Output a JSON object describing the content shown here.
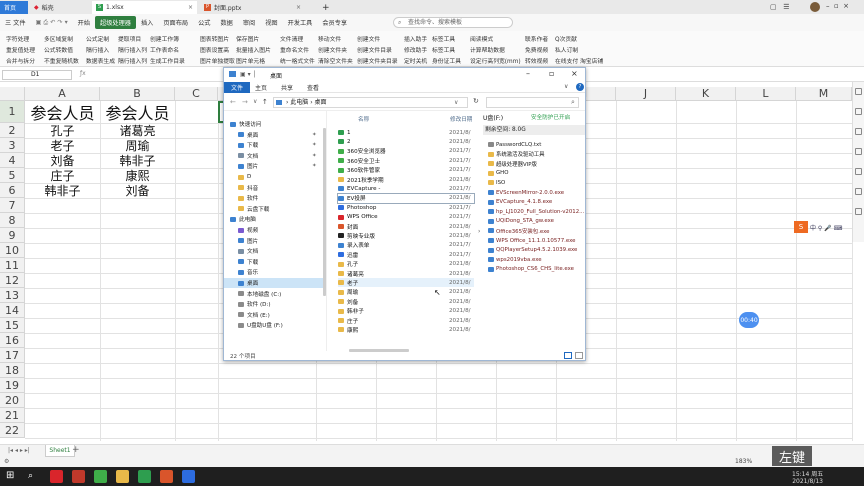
{
  "tabs": [
    {
      "label": "首页"
    },
    {
      "label": "稻壳"
    },
    {
      "label": "1.xlsx"
    },
    {
      "label": "封面.pptx"
    }
  ],
  "menus": [
    "三 文件",
    "开始",
    "超级处理器",
    "插入",
    "页面布局",
    "公式",
    "数据",
    "审阅",
    "视图",
    "开发工具",
    "会员专享"
  ],
  "search_placeholder": "查找命令、搜索模板",
  "ribbon": {
    "row1": [
      "字符处理",
      "多区域复制",
      "公式定制",
      "提取项目",
      "创建工作簿",
      "图表转图片",
      "保存图片",
      "文件清理",
      "移动文件",
      "创建文件",
      "插入助手",
      "标签工具",
      "阅读模式",
      "联系作者",
      "Q次贡献"
    ],
    "row2": [
      "重复值处理",
      "公式转数值",
      "隔行插入",
      "隔行插入列",
      "工作表命名",
      "图表设置高",
      "批量插入图片",
      "重命名文件",
      "创建文件夹",
      "创建文件目录",
      "修改助手",
      "标签工具",
      "计算帮助数据",
      "免费视频",
      "私人订制"
    ],
    "row3": [
      "合并与拆分",
      "不重复随机数",
      "数据表生成",
      "隔行插入列",
      "生成工作目录",
      "图片单独提取",
      "图片单元格",
      "统一格式文件",
      "清除空文件夹",
      "创建文件夹目录",
      "定时关机",
      "身份证工具",
      "设定行高列宽(mm)",
      "转效视频",
      "在线支付",
      "淘宝店铺"
    ]
  },
  "name_box": "D1",
  "columns": [
    "A",
    "B",
    "C",
    "D",
    "E",
    "F",
    "G",
    "H",
    "I",
    "J",
    "K",
    "L",
    "M"
  ],
  "rows": [
    "1",
    "2",
    "3",
    "4",
    "5",
    "6",
    "7",
    "8",
    "9",
    "10",
    "11",
    "12",
    "13",
    "14",
    "15",
    "16",
    "17",
    "18",
    "19",
    "20",
    "21",
    "22"
  ],
  "cells": {
    "a1": "参会人员",
    "b1": "参会人员",
    "a2": "孔子",
    "b2": "诸葛亮",
    "a3": "老子",
    "b3": "周瑜",
    "a4": "刘备",
    "b4": "韩非子",
    "a5": "庄子",
    "b5": "康熙",
    "a6": "韩非子",
    "b6": "刘备"
  },
  "explorer": {
    "title": "桌面",
    "tabs": [
      "文件",
      "主页",
      "共享",
      "查看"
    ],
    "path": "› 此电脑 › 桌面",
    "nav": [
      {
        "label": "快速访问",
        "kind": "star"
      },
      {
        "label": "桌面",
        "kind": "desk"
      },
      {
        "label": "下载",
        "kind": "down"
      },
      {
        "label": "文档",
        "kind": "doc"
      },
      {
        "label": "图片",
        "kind": "pic"
      },
      {
        "label": "D",
        "kind": "fold"
      },
      {
        "label": "抖音",
        "kind": "fold"
      },
      {
        "label": "软件",
        "kind": "fold"
      },
      {
        "label": "云盘下载",
        "kind": "fold"
      },
      {
        "label": "此电脑",
        "kind": "pc"
      },
      {
        "label": "视频",
        "kind": "vid"
      },
      {
        "label": "图片",
        "kind": "pic"
      },
      {
        "label": "文档",
        "kind": "doc"
      },
      {
        "label": "下载",
        "kind": "down"
      },
      {
        "label": "音乐",
        "kind": "mus"
      },
      {
        "label": "桌面",
        "kind": "desk"
      },
      {
        "label": "本地磁盘 (C:)",
        "kind": "drv"
      },
      {
        "label": "软件 (D:)",
        "kind": "drv"
      },
      {
        "label": "文档 (E:)",
        "kind": "drv"
      },
      {
        "label": "U盘助U盘 (F:)",
        "kind": "drv"
      }
    ],
    "col_name": "名称",
    "col_date": "修改日期",
    "files": [
      {
        "name": "1",
        "date": "2021/8/"
      },
      {
        "name": "2",
        "date": "2021/8/"
      },
      {
        "name": "360安全浏览器",
        "date": "2021/7/"
      },
      {
        "name": "360安全卫士",
        "date": "2021/7/"
      },
      {
        "name": "360软件管家",
        "date": "2021/7/"
      },
      {
        "name": "2021秋季学期",
        "date": "2021/8/"
      },
      {
        "name": "EVCapture -",
        "date": "2021/7/"
      },
      {
        "name": "EV投屏",
        "date": "2021/8/"
      },
      {
        "name": "Photoshop",
        "date": "2021/7/"
      },
      {
        "name": "WPS Office",
        "date": "2021/7/"
      },
      {
        "name": "封面",
        "date": "2021/8/"
      },
      {
        "name": "剪映专业版",
        "date": "2021/8/"
      },
      {
        "name": "录入表单",
        "date": "2021/7/"
      },
      {
        "name": "迅雷",
        "date": "2021/7/"
      },
      {
        "name": "孔子",
        "date": "2021/8/"
      },
      {
        "name": "诸葛亮",
        "date": "2021/8/"
      },
      {
        "name": "老子",
        "date": "2021/8/"
      },
      {
        "name": "周瑜",
        "date": "2021/8/"
      },
      {
        "name": "刘备",
        "date": "2021/8/"
      },
      {
        "name": "韩非子",
        "date": "2021/8/"
      },
      {
        "name": "庄子",
        "date": "2021/8/"
      },
      {
        "name": "康熙",
        "date": "2021/8/"
      }
    ],
    "usb_title": "U盘(F:)",
    "usb_protect": "安全防护已开启",
    "usb_free": "剩余空间: 8.0G",
    "usb_files": [
      {
        "name": "PasswordCLQ.txt",
        "kind": "txt"
      },
      {
        "name": "系统激活及驱动工具",
        "kind": "fold"
      },
      {
        "name": "超级处理器VIP版",
        "kind": "fold"
      },
      {
        "name": "GHO",
        "kind": "fold"
      },
      {
        "name": "ISO",
        "kind": "fold"
      },
      {
        "name": "EVScreenMirror-2.0.0.exe",
        "kind": "exe"
      },
      {
        "name": "EVCapture_4.1.8.exe",
        "kind": "exe"
      },
      {
        "name": "hp_LJ1020_Full_Solution-v2012...",
        "kind": "exe"
      },
      {
        "name": "UQiDong_STA_gw.exe",
        "kind": "exe"
      },
      {
        "name": "Office365安装包.exe",
        "kind": "exe"
      },
      {
        "name": "WPS Office_11.1.0.10577.exe",
        "kind": "exe"
      },
      {
        "name": "QQPlayerSetup4.5.2.1039.exe",
        "kind": "exe"
      },
      {
        "name": "wps2019vba.exe",
        "kind": "exe"
      },
      {
        "name": "Photoshop_CS6_CHS_lite.exe",
        "kind": "exe"
      }
    ],
    "status": "22 个项目"
  },
  "sheet_tab": "Sheet1",
  "zoom": "183%",
  "clock": {
    "time": "15:14 周五",
    "date": "2021/8/13"
  },
  "float_badge": "00:40",
  "watermark": "左键"
}
